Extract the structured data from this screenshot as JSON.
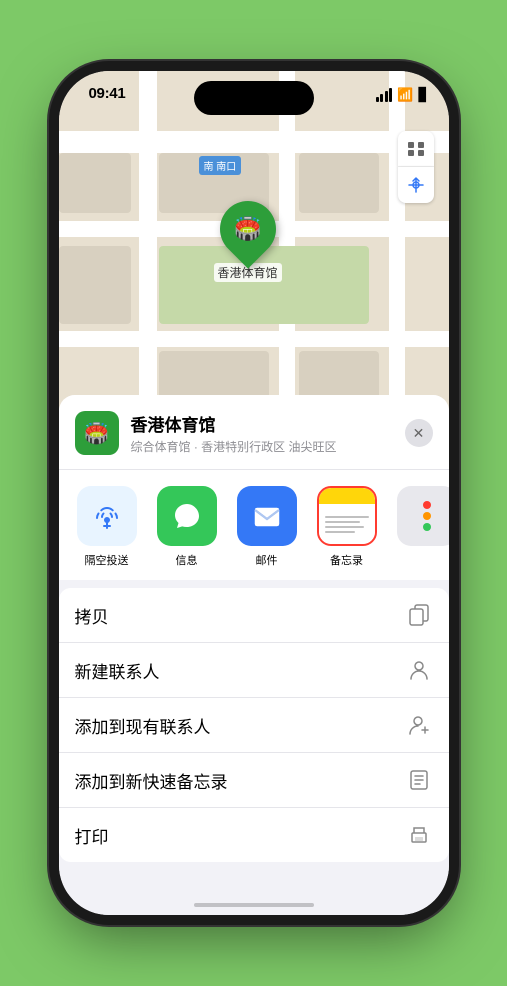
{
  "status": {
    "time": "09:41",
    "location_arrow": "▶"
  },
  "map": {
    "label": "南口",
    "label_prefix": "南",
    "venue_name": "香港体育馆"
  },
  "venue": {
    "name": "香港体育馆",
    "subtitle": "综合体育馆 · 香港特别行政区 油尖旺区",
    "close_label": "×"
  },
  "share_items": [
    {
      "id": "airdrop",
      "label": "隔空投送",
      "type": "airdrop"
    },
    {
      "id": "messages",
      "label": "信息",
      "type": "messages"
    },
    {
      "id": "mail",
      "label": "邮件",
      "type": "mail"
    },
    {
      "id": "notes",
      "label": "备忘录",
      "type": "notes"
    }
  ],
  "actions": [
    {
      "id": "copy",
      "label": "拷贝",
      "icon": "copy"
    },
    {
      "id": "new-contact",
      "label": "新建联系人",
      "icon": "person"
    },
    {
      "id": "add-existing",
      "label": "添加到现有联系人",
      "icon": "person-add"
    },
    {
      "id": "add-notes",
      "label": "添加到新快速备忘录",
      "icon": "notes-add"
    },
    {
      "id": "print",
      "label": "打印",
      "icon": "print"
    }
  ]
}
